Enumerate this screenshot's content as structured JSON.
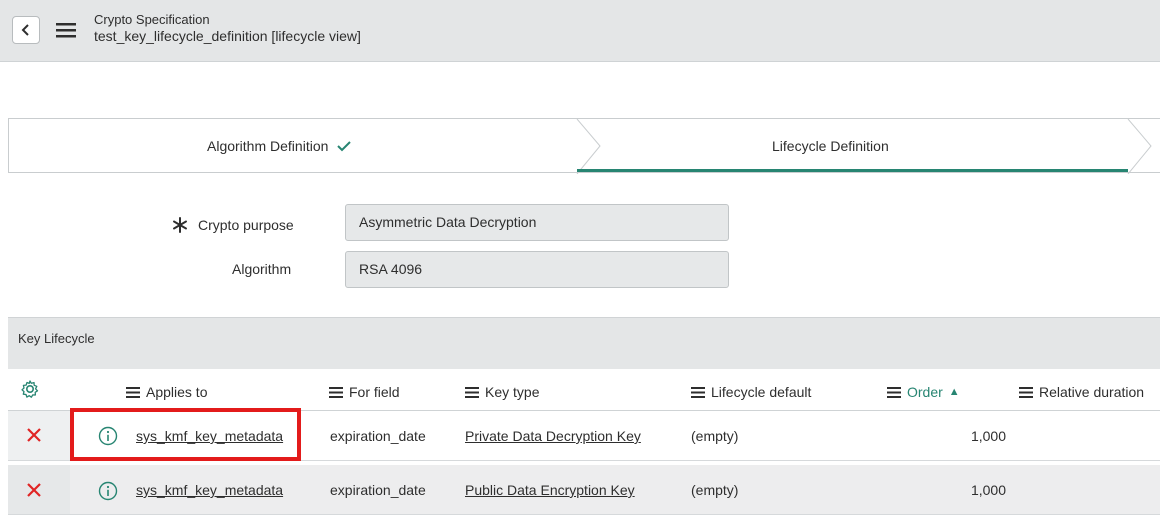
{
  "header": {
    "record_type": "Crypto Specification",
    "record_title": "test_key_lifecycle_definition [lifecycle view]"
  },
  "process_flow": {
    "steps": [
      {
        "label": "Algorithm Definition",
        "state": "complete"
      },
      {
        "label": "Lifecycle Definition",
        "state": "current"
      }
    ]
  },
  "form": {
    "crypto_purpose": {
      "label": "Crypto purpose",
      "value": "Asymmetric Data Decryption",
      "mandatory": true
    },
    "algorithm": {
      "label": "Algorithm",
      "value": "RSA 4096"
    }
  },
  "related_list": {
    "title": "Key Lifecycle",
    "columns": [
      "Applies to",
      "For field",
      "Key type",
      "Lifecycle default",
      "Order",
      "Relative duration"
    ],
    "sort": {
      "column": "Order",
      "direction": "ascending",
      "symbol": "▲"
    },
    "rows": [
      {
        "applies_to": "sys_kmf_key_metadata",
        "for_field": "expiration_date",
        "key_type": "Private Data Decryption Key",
        "lifecycle_default": "(empty)",
        "order": "1,000",
        "highlighted": true
      },
      {
        "applies_to": "sys_kmf_key_metadata",
        "for_field": "expiration_date",
        "key_type": "Public Data Encryption Key",
        "lifecycle_default": "(empty)",
        "order": "1,000",
        "highlighted": false
      }
    ]
  },
  "colors": {
    "accent": "#278572",
    "delete": "#e02424",
    "highlight_box": "#e31b1b",
    "header_bg": "#e4e6e7"
  },
  "icons": [
    "back-arrow-icon",
    "hamburger-menu-icon",
    "checkmark-icon",
    "asterisk-icon",
    "gear-icon",
    "list-bars-icon",
    "delete-x-icon",
    "info-icon"
  ]
}
